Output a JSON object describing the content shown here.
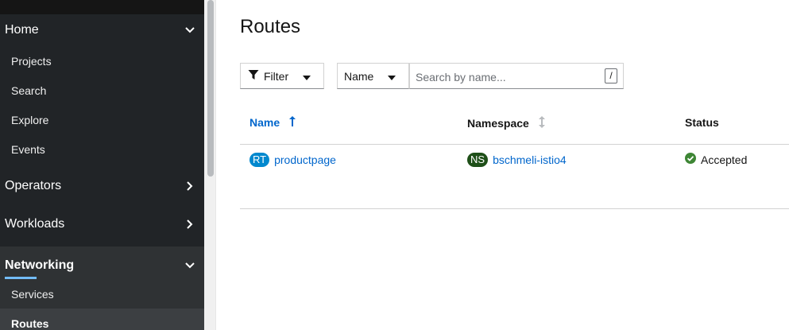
{
  "sidebar": {
    "sections": [
      {
        "label": "Home",
        "expanded": true
      },
      {
        "label": "Operators",
        "expanded": false
      },
      {
        "label": "Workloads",
        "expanded": false
      },
      {
        "label": "Networking",
        "expanded": true,
        "active": true
      }
    ],
    "home_items": [
      "Projects",
      "Search",
      "Explore",
      "Events"
    ],
    "networking_items": [
      "Services",
      "Routes"
    ],
    "current_item": "Routes"
  },
  "page": {
    "title": "Routes"
  },
  "toolbar": {
    "filter_label": "Filter",
    "filter_type": "Name",
    "search_placeholder": "Search by name...",
    "shortcut_key": "/"
  },
  "table": {
    "columns": {
      "name": "Name",
      "namespace": "Namespace",
      "status": "Status"
    },
    "sort": {
      "column": "Name",
      "direction": "ascending"
    },
    "rows": [
      {
        "kind_badge": "RT",
        "name": "productpage",
        "ns_badge": "NS",
        "namespace": "bschmeli-istio4",
        "status": "Accepted"
      }
    ]
  },
  "colors": {
    "sidebar_bg": "#212427",
    "link": "#0066cc",
    "route_badge": "#0088ce",
    "namespace_badge": "#1e4f18",
    "status_ok": "#3e8635",
    "active_indicator": "#73bcf7"
  }
}
